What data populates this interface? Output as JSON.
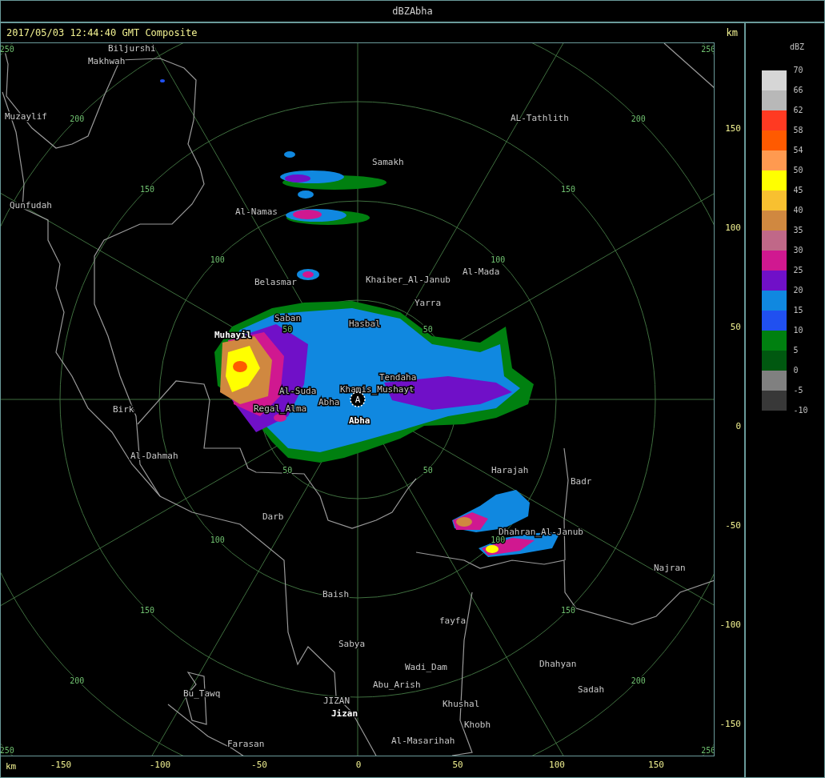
{
  "window": {
    "title": "dBZAbha"
  },
  "header": {
    "timestamp": "2017/05/03 12:44:40 GMT Composite",
    "unit": "km"
  },
  "map": {
    "site_marker": "A",
    "range_rings": [
      {
        "labels": [
          "50",
          "50",
          "50",
          "50"
        ]
      },
      {
        "labels": [
          "100",
          "100",
          "100",
          "100"
        ]
      },
      {
        "labels": [
          "150",
          "150",
          "150",
          "150"
        ]
      },
      {
        "labels": [
          "200",
          "200",
          "200",
          "200"
        ]
      },
      {
        "labels": [
          "250",
          "250",
          "250",
          "250"
        ]
      }
    ],
    "places": [
      {
        "name": "Biljurshi",
        "kind": "minor"
      },
      {
        "name": "Makhwah",
        "kind": "minor"
      },
      {
        "name": "Muzaylif",
        "kind": "minor"
      },
      {
        "name": "Qunfudah",
        "kind": "minor"
      },
      {
        "name": "Al-Namas",
        "kind": "minor"
      },
      {
        "name": "Samakh",
        "kind": "minor"
      },
      {
        "name": "AL-Tathlith",
        "kind": "minor"
      },
      {
        "name": "Belasmar",
        "kind": "minor"
      },
      {
        "name": "Khaiber_Al-Janub",
        "kind": "minor"
      },
      {
        "name": "Al-Mada",
        "kind": "minor"
      },
      {
        "name": "Yarra",
        "kind": "minor"
      },
      {
        "name": "Saban",
        "kind": "minor"
      },
      {
        "name": "Hasbal",
        "kind": "minor"
      },
      {
        "name": "Muhayil",
        "kind": "major"
      },
      {
        "name": "Tendaha",
        "kind": "minor"
      },
      {
        "name": "Al-Suda",
        "kind": "minor"
      },
      {
        "name": "Khamis_Mushayt",
        "kind": "minor"
      },
      {
        "name": "Abha",
        "kind": "minor"
      },
      {
        "name": "Regal_Alma",
        "kind": "minor"
      },
      {
        "name": "Abha",
        "kind": "major"
      },
      {
        "name": "Birk",
        "kind": "minor"
      },
      {
        "name": "Al-Dahmah",
        "kind": "minor"
      },
      {
        "name": "Darb",
        "kind": "minor"
      },
      {
        "name": "Harajah",
        "kind": "minor"
      },
      {
        "name": "Badr",
        "kind": "minor"
      },
      {
        "name": "Dhahran_Al-Janub",
        "kind": "minor"
      },
      {
        "name": "Najran",
        "kind": "minor"
      },
      {
        "name": "Baish",
        "kind": "minor"
      },
      {
        "name": "fayfa",
        "kind": "minor"
      },
      {
        "name": "Sabya",
        "kind": "minor"
      },
      {
        "name": "Wadi_Dam",
        "kind": "minor"
      },
      {
        "name": "Dhahyan",
        "kind": "minor"
      },
      {
        "name": "Abu_Arish",
        "kind": "minor"
      },
      {
        "name": "Sadah",
        "kind": "minor"
      },
      {
        "name": "Bu_Tawq",
        "kind": "minor"
      },
      {
        "name": "JIZAN",
        "kind": "minor"
      },
      {
        "name": "Jizan",
        "kind": "major"
      },
      {
        "name": "Khushal",
        "kind": "minor"
      },
      {
        "name": "Khobh",
        "kind": "minor"
      },
      {
        "name": "Farasan",
        "kind": "minor"
      },
      {
        "name": "Al-Masarihah",
        "kind": "minor"
      }
    ]
  },
  "y_axis": {
    "ticks": [
      "150",
      "100",
      "50",
      "0",
      "-50",
      "-100",
      "-150"
    ]
  },
  "x_axis": {
    "unit": "km",
    "ticks": [
      "-150",
      "-100",
      "-50",
      "0",
      "50",
      "100",
      "150"
    ]
  },
  "legend": {
    "title": "dBZ",
    "labels": [
      "70",
      "66",
      "62",
      "58",
      "54",
      "50",
      "45",
      "40",
      "35",
      "30",
      "25",
      "20",
      "15",
      "10",
      "5",
      "0",
      "-5",
      "-10"
    ],
    "bands": [
      {
        "color": "#d6d6d6"
      },
      {
        "color": "#b8b8b8"
      },
      {
        "color": "#ff3a22"
      },
      {
        "color": "#ff5a00"
      },
      {
        "color": "#ff9a50"
      },
      {
        "color": "#ffff00"
      },
      {
        "color": "#f8c030"
      },
      {
        "color": "#d08840"
      },
      {
        "color": "#c06888"
      },
      {
        "color": "#d01890"
      },
      {
        "color": "#7010c8"
      },
      {
        "color": "#1088e0"
      },
      {
        "color": "#2050f0"
      },
      {
        "color": "#008010"
      },
      {
        "color": "#005810"
      },
      {
        "color": "#808080"
      },
      {
        "color": "#383838"
      }
    ]
  }
}
